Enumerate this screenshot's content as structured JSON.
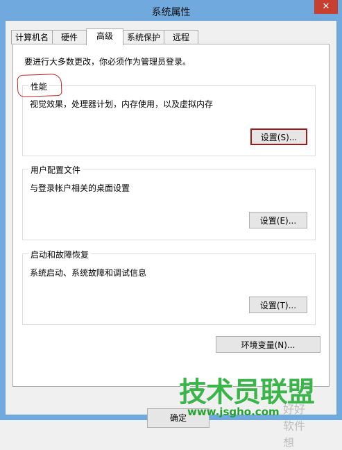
{
  "window": {
    "title": "系统属性",
    "close_glyph": "✕"
  },
  "tabs": [
    {
      "label": "计算机名"
    },
    {
      "label": "硬件"
    },
    {
      "label": "高级",
      "active": true
    },
    {
      "label": "系统保护"
    },
    {
      "label": "远程"
    }
  ],
  "admin_note": "要进行大多数更改，你必须作为管理员登录。",
  "performance": {
    "title": "性能",
    "description": "视觉效果，处理器计划，内存使用，以及虚拟内存",
    "settings_label": "设置(S)..."
  },
  "user_profiles": {
    "title": "用户配置文件",
    "description": "与登录帐户相关的桌面设置",
    "settings_label": "设置(E)..."
  },
  "startup_recovery": {
    "title": "启动和故障恢复",
    "description": "系统启动、系统故障和调试信息",
    "settings_label": "设置(T)..."
  },
  "env_vars_label": "环境变量(N)...",
  "ok_label": "确定",
  "watermark": {
    "main": "技术员联盟",
    "url": "www.jsgho.com",
    "faint": "好好软件想"
  },
  "colors": {
    "titlebar": "#6fa9de",
    "close": "#c7402f",
    "annotation": "#c8202a",
    "watermark": "#3bb54a"
  }
}
